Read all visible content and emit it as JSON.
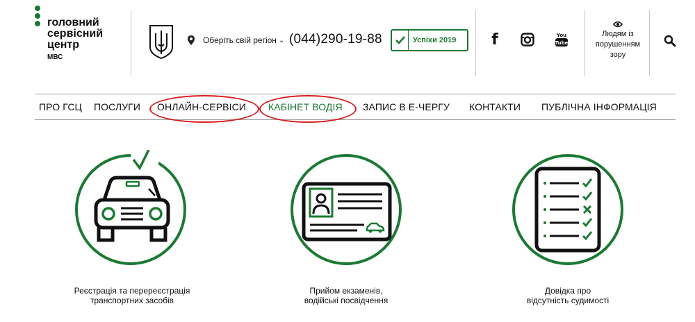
{
  "logo": {
    "line1": "головний",
    "line2": "сервісний",
    "line3": "центр",
    "sub": "МВС"
  },
  "header": {
    "region_label": "Оберіть свій регіон",
    "phone": "(044)290-19-88",
    "success_label": "Успіхи 2019",
    "vision_line1": "Людям із",
    "vision_line2": "порушенням",
    "vision_line3": "зору"
  },
  "icons": {
    "emblem": "trident-emblem-icon",
    "pin": "location-pin-icon",
    "check": "check-icon",
    "facebook": "facebook-icon",
    "instagram": "instagram-icon",
    "youtube": "youtube-icon",
    "eye": "eye-icon",
    "search": "search-icon"
  },
  "nav": {
    "items": [
      "ПРО ГСЦ",
      "ПОСЛУГИ",
      "ОНЛАЙН-СЕРВІСИ",
      "КАБІНЕТ ВОДІЯ",
      "ЗАПИС В Е-ЧЕРГУ",
      "КОНТАКТИ",
      "ПУБЛІЧНА ІНФОРМАЦІЯ"
    ]
  },
  "services": [
    {
      "icon": "car-registration-icon",
      "line1": "Реєстрація та перереєстрація",
      "line2": "транспортних засобів"
    },
    {
      "icon": "driver-license-icon",
      "line1": "Прийом екзаменів,",
      "line2": "водійські посвідчення"
    },
    {
      "icon": "checklist-certificate-icon",
      "line1": "Довідка про",
      "line2": "відсутність судимості"
    }
  ],
  "colors": {
    "brand_green": "#1a7a32",
    "highlight_red": "#d81e1e",
    "text": "#111111"
  }
}
